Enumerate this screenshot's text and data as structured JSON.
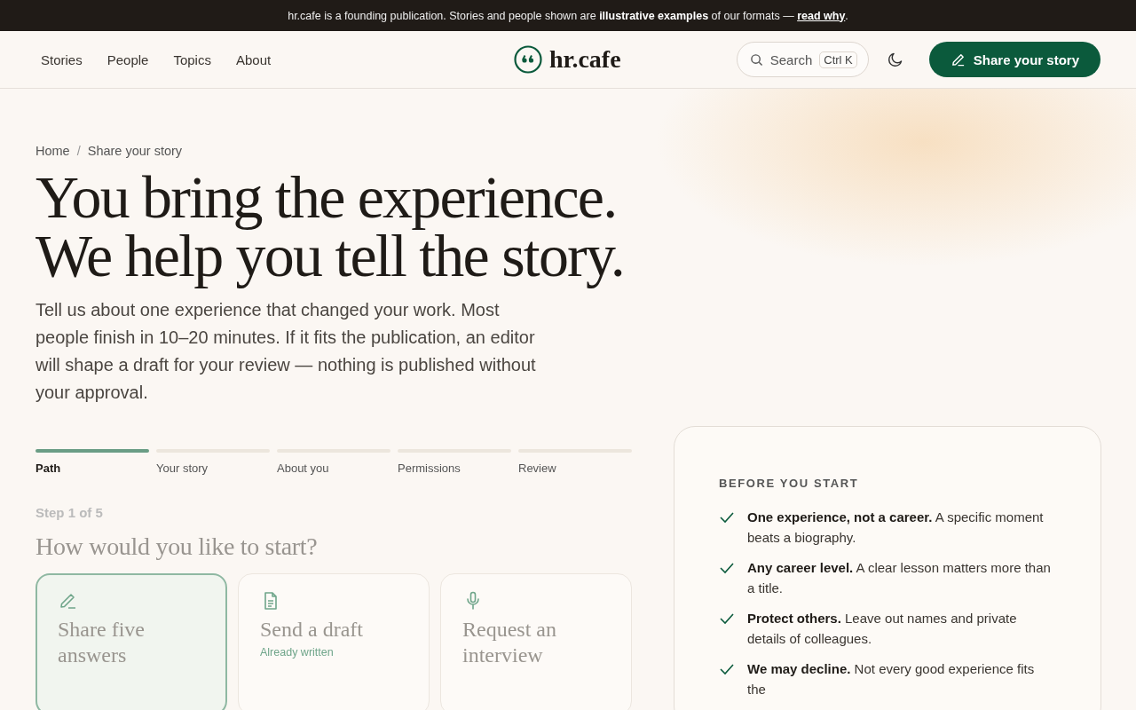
{
  "notice": {
    "text": "hr.cafe is a founding publication. Stories and people shown are **illustrative examples** of our formats — ",
    "link": "read why",
    "after": "."
  },
  "nav": {
    "links": [
      "Stories",
      "People",
      "Topics",
      "About"
    ],
    "logo": "hr.cafe",
    "search": {
      "label": "Search",
      "shortcut": "Ctrl K"
    },
    "cta": "Share your story"
  },
  "breadcrumb": [
    "Home",
    "Share your story"
  ],
  "breadcrumb_separator": "/",
  "headline": [
    "You bring the experience.",
    "We help you tell the story."
  ],
  "lead": "Tell us about one experience that changed your work. Most people finish in 10–20 minutes. If it fits the publication, an editor will shape a draft for your review — nothing is published without your approval.",
  "steps": [
    {
      "label": "Path",
      "selected": true
    },
    {
      "label": "Your story",
      "selected": false
    },
    {
      "label": "About you",
      "selected": false
    },
    {
      "label": "Permissions",
      "selected": false
    },
    {
      "label": "Review",
      "selected": false
    }
  ],
  "step_counter": "Step 1 of 5",
  "question": "How would you like to start?",
  "options": [
    {
      "kind": "pencil",
      "title": "Share five answers",
      "selected": true
    },
    {
      "kind": "document",
      "title": "Send a draft",
      "note": "Already written",
      "selected": false
    },
    {
      "kind": "microphone",
      "title": "Request an interview",
      "selected": false
    }
  ],
  "tips": {
    "heading": "BEFORE YOU START",
    "items": [
      {
        "text": "**One experience, not a career.** A specific moment beats a biography."
      },
      {
        "text": "**Any career level.** A clear lesson matters more than a title."
      },
      {
        "text": "**Protect others.** Leave out names and private details of colleagues."
      },
      {
        "text": "**We may decline.** Not every good experience fits the"
      }
    ]
  }
}
